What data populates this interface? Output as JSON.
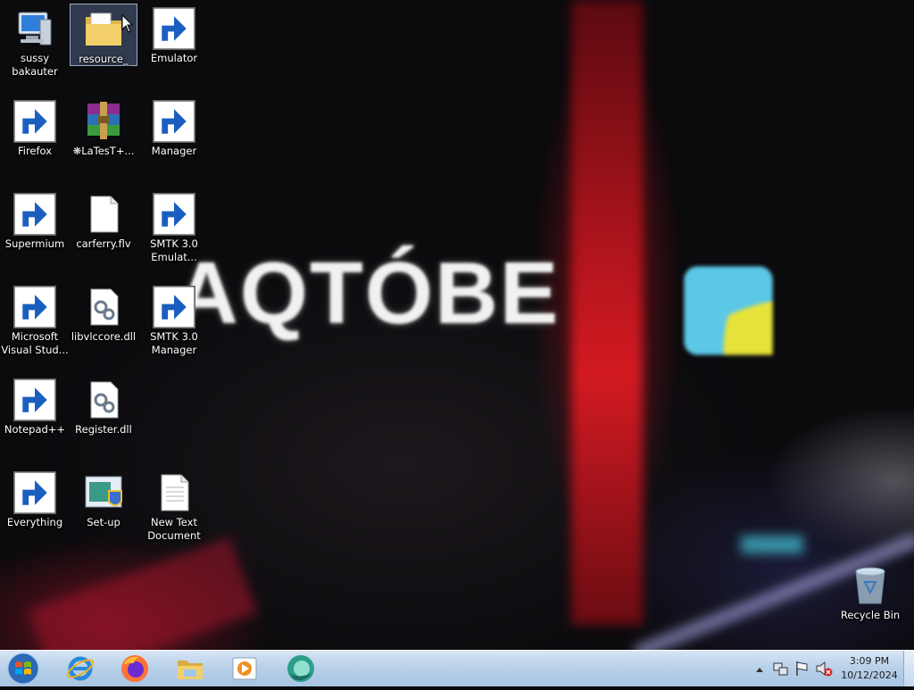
{
  "desktop": {
    "icons": [
      {
        "label": "sussy bakauter",
        "icon": "computer-icon"
      },
      {
        "label": "resource_",
        "icon": "folder-icon"
      },
      {
        "label": "Emulator",
        "icon": "emulator-icon"
      },
      {
        "label": "Firefox",
        "icon": "firefox-icon"
      },
      {
        "label": "❋LaTesT+...",
        "icon": "winrar-archive-icon"
      },
      {
        "label": "Manager",
        "icon": "manager-icon"
      },
      {
        "label": "Supermium",
        "icon": "supermium-icon"
      },
      {
        "label": "carferry.flv",
        "icon": "file-icon"
      },
      {
        "label": "SMTK 3.0 Emulat...",
        "icon": "smtk-emulator-icon"
      },
      {
        "label": "Microsoft Visual Stud...",
        "icon": "visual-studio-icon"
      },
      {
        "label": "libvlccore.dll",
        "icon": "dll-file-icon"
      },
      {
        "label": "SMTK 3.0 Manager",
        "icon": "smtk-manager-icon"
      },
      {
        "label": "Notepad++",
        "icon": "notepadpp-icon"
      },
      {
        "label": "Register.dll",
        "icon": "dll-file-icon"
      },
      {
        "label": "Everything",
        "icon": "everything-search-icon"
      },
      {
        "label": "Set-up",
        "icon": "setup-installer-icon"
      },
      {
        "label": "New Text Document",
        "icon": "text-document-icon"
      },
      {
        "label": "Recycle Bin",
        "icon": "recycle-bin-icon"
      }
    ],
    "wallpaper_text": "AQTÓBE"
  },
  "taskbar": {
    "pinned": [
      {
        "name": "Internet Explorer",
        "icon": "internet-explorer-icon"
      },
      {
        "name": "Firefox",
        "icon": "firefox-icon"
      },
      {
        "name": "File Explorer",
        "icon": "folder-icon"
      },
      {
        "name": "Media Player",
        "icon": "media-player-icon"
      },
      {
        "name": "Supermium",
        "icon": "supermium-icon"
      }
    ],
    "tray": {
      "time": "3:09 PM",
      "date": "10/12/2024",
      "icons": [
        "show-hidden-icons-arrow",
        "network-icon",
        "action-center-flag-icon",
        "volume-muted-icon"
      ]
    }
  },
  "colors": {
    "taskbar": "#b9d1ea",
    "selection": "#7896c8",
    "wallpaper_red": "#c8141e"
  }
}
